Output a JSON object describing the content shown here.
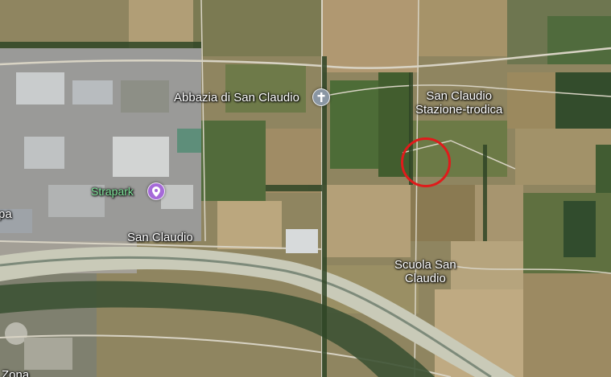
{
  "map": {
    "view": "satellite",
    "labels": {
      "abbey": "Abbazia di San Claudio",
      "station_line1": "San Claudio",
      "station_line2": "Stazione-trodica",
      "strapark": "Strapark",
      "town": "San Claudio",
      "school_line1": "Scuola San",
      "school_line2": "Claudio",
      "edge_left": "pa",
      "edge_bottom": "Zona"
    },
    "pins": {
      "abbey_pin": {
        "icon": "cross-icon",
        "color": "#8a96a3"
      },
      "strapark_pin": {
        "icon": "map-pin-icon",
        "color": "#a56ad8"
      }
    },
    "highlight": {
      "icon": "red-circle-marker",
      "color": "#e01b1b"
    }
  }
}
